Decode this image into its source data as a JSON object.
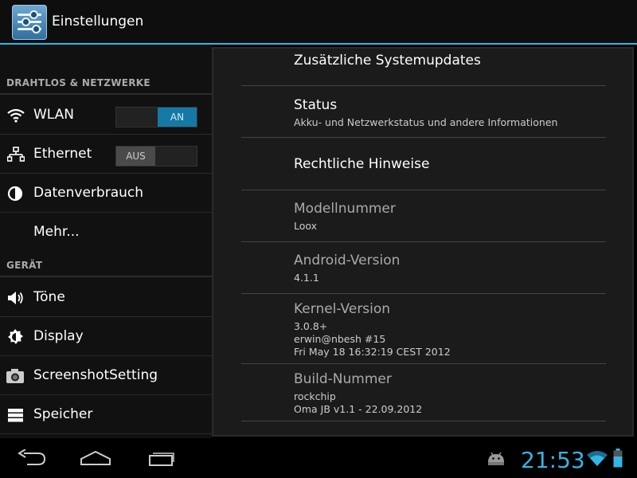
{
  "window": {
    "title": "Einstellungen"
  },
  "colors": {
    "accent": "#33b5e5",
    "toggle_on": "#1479a5"
  },
  "left_pane": {
    "sections": [
      {
        "header": "DRAHTLOS & NETZWERKE"
      },
      {
        "header": "GERÄT"
      }
    ],
    "items": [
      {
        "label": "WLAN",
        "icon": "wifi-icon",
        "toggle": "AN"
      },
      {
        "label": "Ethernet",
        "icon": "ethernet-icon",
        "toggle": "AUS"
      },
      {
        "label": "Datenverbrauch",
        "icon": "data-usage-icon"
      },
      {
        "label": "Mehr...",
        "icon": ""
      },
      {
        "label": "Töne",
        "icon": "speaker-icon"
      },
      {
        "label": "Display",
        "icon": "brightness-icon"
      },
      {
        "label": "ScreenshotSetting",
        "icon": "camera-icon"
      },
      {
        "label": "Speicher",
        "icon": "storage-icon"
      }
    ]
  },
  "right_pane": {
    "rows": [
      {
        "title": "Zusätzliche Systemupdates"
      },
      {
        "title": "Status",
        "summary": "Akku- und Netzwerkstatus und andere Informationen"
      },
      {
        "title": "Rechtliche Hinweise"
      },
      {
        "title": "Modellnummer",
        "summary": "Loox"
      },
      {
        "title": "Android-Version",
        "summary": "4.1.1"
      },
      {
        "title": "Kernel-Version",
        "summary_lines": [
          "3.0.8+",
          "erwin@nbesh #15",
          "Fri May 18 16:32:19 CEST 2012"
        ]
      },
      {
        "title": "Build-Nummer",
        "summary_lines": [
          "rockchip",
          "Oma JB v1.1 - 22.09.2012"
        ]
      }
    ]
  },
  "navbar": {
    "buttons": [
      "back-icon",
      "home-icon",
      "recent-apps-icon"
    ],
    "status": {
      "time": "21:53",
      "icons": [
        "android-debug-icon",
        "wifi-signal-icon",
        "battery-icon"
      ]
    }
  }
}
